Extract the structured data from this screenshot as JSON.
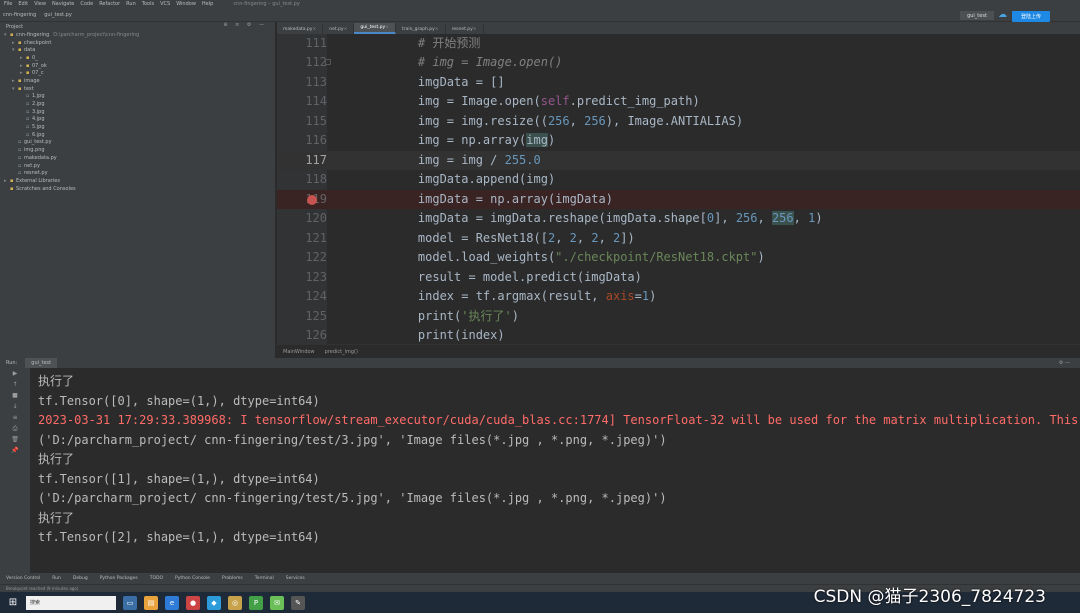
{
  "menubar": {
    "items": [
      "File",
      "Edit",
      "View",
      "Navigate",
      "Code",
      "Refactor",
      "Run",
      "Tools",
      "VCS",
      "Window",
      "Help"
    ],
    "title": "cnn-fingering – gui_test.py"
  },
  "navbar": {
    "crumbs": [
      "cnn-fingering",
      "gui_test.py"
    ],
    "run_config": "gui_test",
    "login": "登陆上传"
  },
  "project": {
    "title": "Project",
    "rows": [
      {
        "indent": 0,
        "arrow": "▾",
        "name": "cnn-fingering",
        "sub": "D:\\parcharm_project\\cnn-fingering"
      },
      {
        "indent": 1,
        "arrow": "▸",
        "name": "checkpoint",
        "sub": ""
      },
      {
        "indent": 1,
        "arrow": "▾",
        "name": "data",
        "sub": ""
      },
      {
        "indent": 2,
        "arrow": "▸",
        "name": "0_",
        "sub": ""
      },
      {
        "indent": 2,
        "arrow": "▸",
        "name": "07_ok",
        "sub": ""
      },
      {
        "indent": 2,
        "arrow": "▸",
        "name": "07_c",
        "sub": ""
      },
      {
        "indent": 1,
        "arrow": "▸",
        "name": "image",
        "sub": ""
      },
      {
        "indent": 1,
        "arrow": "▾",
        "name": "test",
        "sub": ""
      },
      {
        "indent": 2,
        "arrow": "",
        "name": "1.jpg",
        "sub": ""
      },
      {
        "indent": 2,
        "arrow": "",
        "name": "2.jpg",
        "sub": ""
      },
      {
        "indent": 2,
        "arrow": "",
        "name": "3.jpg",
        "sub": ""
      },
      {
        "indent": 2,
        "arrow": "",
        "name": "4.jpg",
        "sub": ""
      },
      {
        "indent": 2,
        "arrow": "",
        "name": "5.jpg",
        "sub": ""
      },
      {
        "indent": 2,
        "arrow": "",
        "name": "6.jpg",
        "sub": ""
      },
      {
        "indent": 1,
        "arrow": "",
        "name": "gui_test.py",
        "sub": ""
      },
      {
        "indent": 1,
        "arrow": "",
        "name": "img.png",
        "sub": ""
      },
      {
        "indent": 1,
        "arrow": "",
        "name": "makedata.py",
        "sub": ""
      },
      {
        "indent": 1,
        "arrow": "",
        "name": "net.py",
        "sub": ""
      },
      {
        "indent": 1,
        "arrow": "",
        "name": "resnet.py",
        "sub": ""
      },
      {
        "indent": 0,
        "arrow": "▸",
        "name": "External Libraries",
        "sub": ""
      },
      {
        "indent": 0,
        "arrow": "",
        "name": "Scratches and Consoles",
        "sub": ""
      }
    ]
  },
  "tabs": [
    {
      "label": "makedata.py",
      "active": false
    },
    {
      "label": "net.py",
      "active": false
    },
    {
      "label": "gui_test.py",
      "active": true
    },
    {
      "label": "train_graph.py",
      "active": false
    },
    {
      "label": "resnet.py",
      "active": false
    }
  ],
  "editor": {
    "current_line": 117,
    "breakpoint_line": 119,
    "lines": [
      {
        "n": 111,
        "parts": [
          [
            "    ",
            ""
          ],
          [
            "# 开始预测",
            "kw-cn"
          ]
        ]
      },
      {
        "n": 112,
        "parts": [
          [
            "    ",
            ""
          ],
          [
            "# img = Image.open()",
            "kw-com"
          ]
        ]
      },
      {
        "n": 113,
        "parts": [
          [
            "    imgData = []",
            ""
          ]
        ]
      },
      {
        "n": 114,
        "parts": [
          [
            "    img = Image.open(",
            ""
          ],
          [
            "self",
            "self"
          ],
          [
            ".predict_img_path)",
            ""
          ]
        ]
      },
      {
        "n": 115,
        "parts": [
          [
            "    img = img.resize((",
            ""
          ],
          [
            "256",
            "num"
          ],
          [
            ", ",
            ""
          ],
          [
            "256",
            "num"
          ],
          [
            "), Image.ANTIALIAS)",
            ""
          ]
        ]
      },
      {
        "n": 116,
        "parts": [
          [
            "    img = np.array(",
            ""
          ],
          [
            "img",
            "hl"
          ],
          [
            ")",
            ""
          ]
        ]
      },
      {
        "n": 117,
        "parts": [
          [
            "    img = img / ",
            ""
          ],
          [
            "255.0",
            "num"
          ]
        ]
      },
      {
        "n": 118,
        "parts": [
          [
            "    imgData.append(img)",
            ""
          ]
        ]
      },
      {
        "n": 119,
        "parts": [
          [
            "    imgData = np.array(imgData)",
            ""
          ]
        ]
      },
      {
        "n": 120,
        "parts": [
          [
            "    imgData = imgData.reshape(imgData.shape[",
            ""
          ],
          [
            "0",
            "num"
          ],
          [
            "], ",
            ""
          ],
          [
            "256",
            "num"
          ],
          [
            ", ",
            ""
          ],
          [
            "256",
            "num hl"
          ],
          [
            ", ",
            ""
          ],
          [
            "1",
            "num"
          ],
          [
            ")",
            ""
          ]
        ]
      },
      {
        "n": 121,
        "parts": [
          [
            "    model = ResNet18([",
            ""
          ],
          [
            "2",
            "num"
          ],
          [
            ", ",
            ""
          ],
          [
            "2",
            "num"
          ],
          [
            ", ",
            ""
          ],
          [
            "2",
            "num"
          ],
          [
            ", ",
            ""
          ],
          [
            "2",
            "num"
          ],
          [
            "])",
            ""
          ]
        ]
      },
      {
        "n": 122,
        "parts": [
          [
            "    model.load_weights(",
            ""
          ],
          [
            "\"./checkpoint/ResNet18.ckpt\"",
            "str"
          ],
          [
            ")",
            ""
          ]
        ]
      },
      {
        "n": 123,
        "parts": [
          [
            "    result = model.predict(imgData)",
            ""
          ]
        ]
      },
      {
        "n": 124,
        "parts": [
          [
            "    index = tf.argmax(result, ",
            ""
          ],
          [
            "axis",
            "param"
          ],
          [
            "=",
            ""
          ],
          [
            "1",
            "num"
          ],
          [
            ")",
            ""
          ]
        ]
      },
      {
        "n": 125,
        "parts": [
          [
            "    print(",
            ""
          ],
          [
            "'执行了'",
            "str"
          ],
          [
            ")",
            ""
          ]
        ]
      },
      {
        "n": 126,
        "parts": [
          [
            "    print(index)",
            ""
          ]
        ]
      }
    ],
    "crumbs": [
      "MainWindow",
      "predict_img()"
    ]
  },
  "run": {
    "label": "Run:",
    "tab": "gui_test",
    "console": [
      {
        "text": "执行了",
        "err": false
      },
      {
        "text": "tf.Tensor([0], shape=(1,), dtype=int64)",
        "err": false
      },
      {
        "text": "2023-03-31 17:29:33.389968: I tensorflow/stream_executor/cuda/cuda_blas.cc:1774] TensorFloat-32 will be used for the matrix multiplication. This",
        "err": true
      },
      {
        "text": "('D:/parcharm_project/ cnn-fingering/test/3.jpg', 'Image files(*.jpg , *.png, *.jpeg)')",
        "err": false
      },
      {
        "text": "执行了",
        "err": false
      },
      {
        "text": "tf.Tensor([1], shape=(1,), dtype=int64)",
        "err": false
      },
      {
        "text": "('D:/parcharm_project/ cnn-fingering/test/5.jpg', 'Image files(*.jpg , *.png, *.jpeg)')",
        "err": false
      },
      {
        "text": "执行了",
        "err": false
      },
      {
        "text": "tf.Tensor([2], shape=(1,), dtype=int64)",
        "err": false
      }
    ]
  },
  "bottom_tools": [
    "Version Control",
    "Run",
    "Debug",
    "Python Packages",
    "TODO",
    "Python Console",
    "Problems",
    "Terminal",
    "Services"
  ],
  "status": "Breakpoint reached (9 minutes ago)",
  "taskbar": {
    "search": "搜索"
  },
  "watermark": "CSDN @猫子2306_7824723",
  "colors": {
    "accent": "#4a88c7",
    "breakpoint": "#c75450",
    "error_text": "#ff6b68"
  }
}
